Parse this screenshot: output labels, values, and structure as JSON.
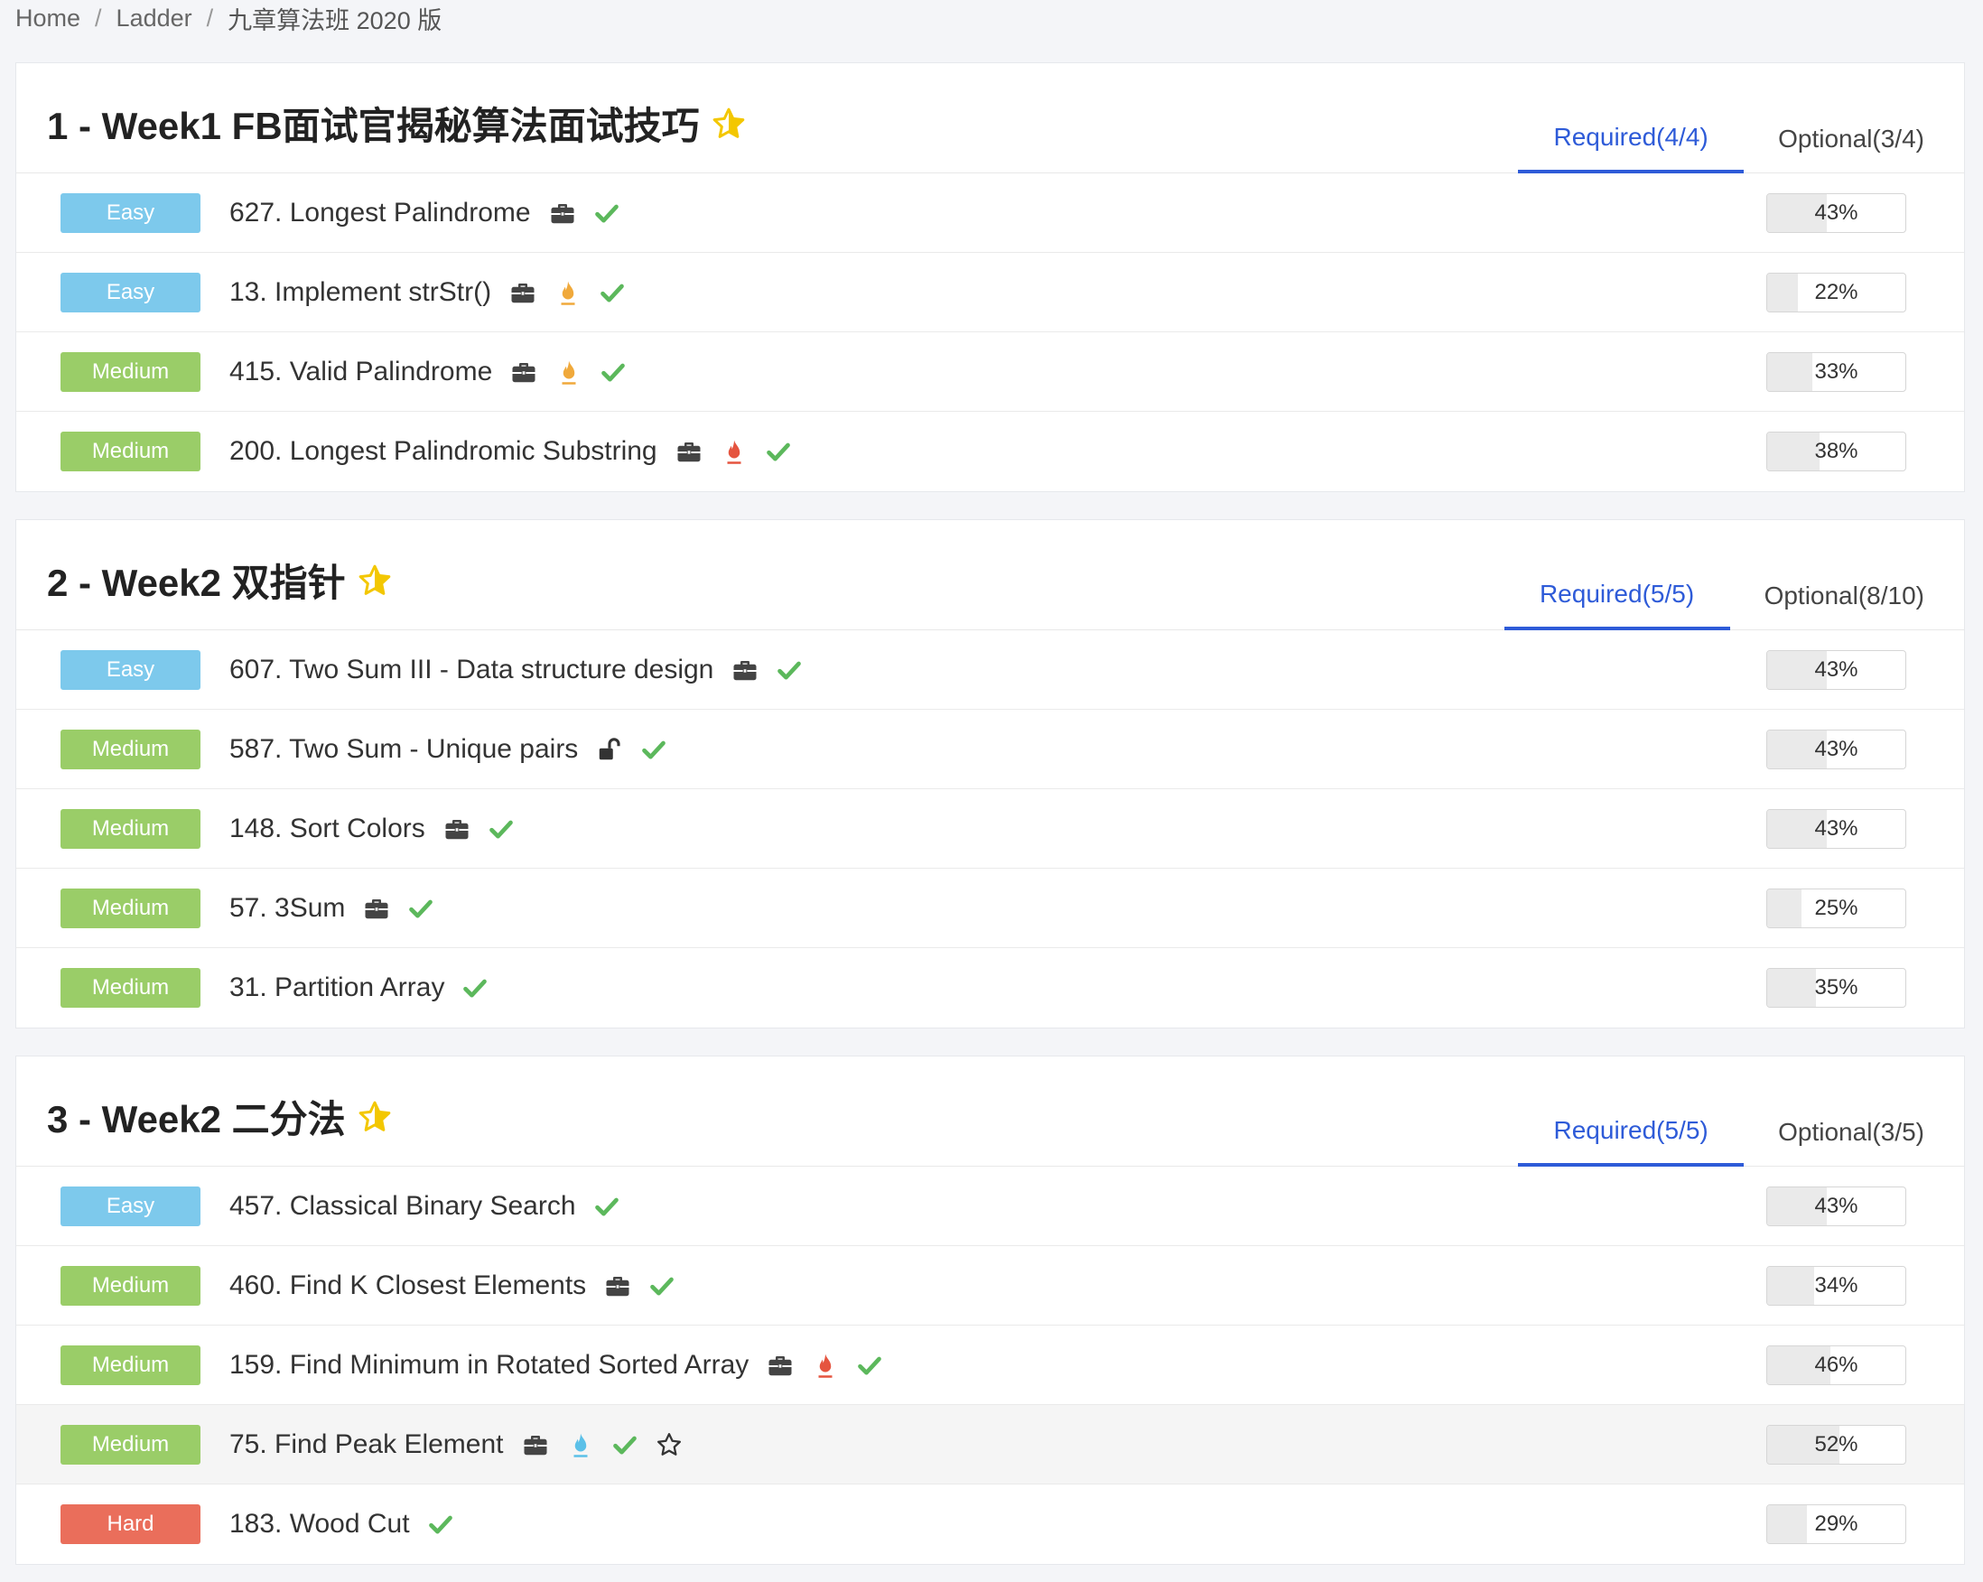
{
  "breadcrumb": {
    "home": "Home",
    "ladder": "Ladder",
    "current": "九章算法班 2020 版"
  },
  "colors": {
    "accent": "#2e5bd8",
    "easy": "#7dc9ec",
    "medium": "#9acd68",
    "hard": "#ea6e5b",
    "check": "#5cb85c",
    "star": "#f3c700"
  },
  "sections": [
    {
      "title": "1 - Week1 FB面试官揭秘算法面试技巧",
      "tabs": {
        "required": "Required(4/4)",
        "optional": "Optional(3/4)"
      },
      "problems": [
        {
          "level": "Easy",
          "title": "627. Longest Palindrome",
          "icons": [
            "briefcase-icon",
            "check-icon"
          ],
          "progress": 43,
          "pct": "43%"
        },
        {
          "level": "Easy",
          "title": "13. Implement strStr()",
          "icons": [
            "briefcase-icon",
            "flame-orange-icon",
            "check-icon"
          ],
          "progress": 22,
          "pct": "22%"
        },
        {
          "level": "Medium",
          "title": "415. Valid Palindrome",
          "icons": [
            "briefcase-icon",
            "flame-orange-icon",
            "check-icon"
          ],
          "progress": 33,
          "pct": "33%"
        },
        {
          "level": "Medium",
          "title": "200. Longest Palindromic Substring",
          "icons": [
            "briefcase-icon",
            "flame-red-icon",
            "check-icon"
          ],
          "progress": 38,
          "pct": "38%"
        }
      ]
    },
    {
      "title": "2 - Week2 双指针",
      "tabs": {
        "required": "Required(5/5)",
        "optional": "Optional(8/10)"
      },
      "problems": [
        {
          "level": "Easy",
          "title": "607. Two Sum III - Data structure design",
          "icons": [
            "briefcase-icon",
            "check-icon"
          ],
          "progress": 43,
          "pct": "43%"
        },
        {
          "level": "Medium",
          "title": "587. Two Sum - Unique pairs",
          "icons": [
            "unlock-icon",
            "check-icon"
          ],
          "progress": 43,
          "pct": "43%"
        },
        {
          "level": "Medium",
          "title": "148. Sort Colors",
          "icons": [
            "briefcase-icon",
            "check-icon"
          ],
          "progress": 43,
          "pct": "43%"
        },
        {
          "level": "Medium",
          "title": "57. 3Sum",
          "icons": [
            "briefcase-icon",
            "check-icon"
          ],
          "progress": 25,
          "pct": "25%"
        },
        {
          "level": "Medium",
          "title": "31. Partition Array",
          "icons": [
            "check-icon"
          ],
          "progress": 35,
          "pct": "35%"
        }
      ]
    },
    {
      "title": "3 - Week2 二分法",
      "tabs": {
        "required": "Required(5/5)",
        "optional": "Optional(3/5)"
      },
      "problems": [
        {
          "level": "Easy",
          "title": "457. Classical Binary Search",
          "icons": [
            "check-icon"
          ],
          "progress": 43,
          "pct": "43%"
        },
        {
          "level": "Medium",
          "title": "460. Find K Closest Elements",
          "icons": [
            "briefcase-icon",
            "check-icon"
          ],
          "progress": 34,
          "pct": "34%"
        },
        {
          "level": "Medium",
          "title": "159. Find Minimum in Rotated Sorted Array",
          "icons": [
            "briefcase-icon",
            "flame-red-icon",
            "check-icon"
          ],
          "progress": 46,
          "pct": "46%"
        },
        {
          "level": "Medium",
          "title": "75. Find Peak Element",
          "icons": [
            "briefcase-icon",
            "flame-blue-icon",
            "check-icon",
            "star-outline-icon"
          ],
          "progress": 52,
          "pct": "52%",
          "hover": true
        },
        {
          "level": "Hard",
          "title": "183. Wood Cut",
          "icons": [
            "check-icon"
          ],
          "progress": 29,
          "pct": "29%"
        }
      ]
    }
  ]
}
